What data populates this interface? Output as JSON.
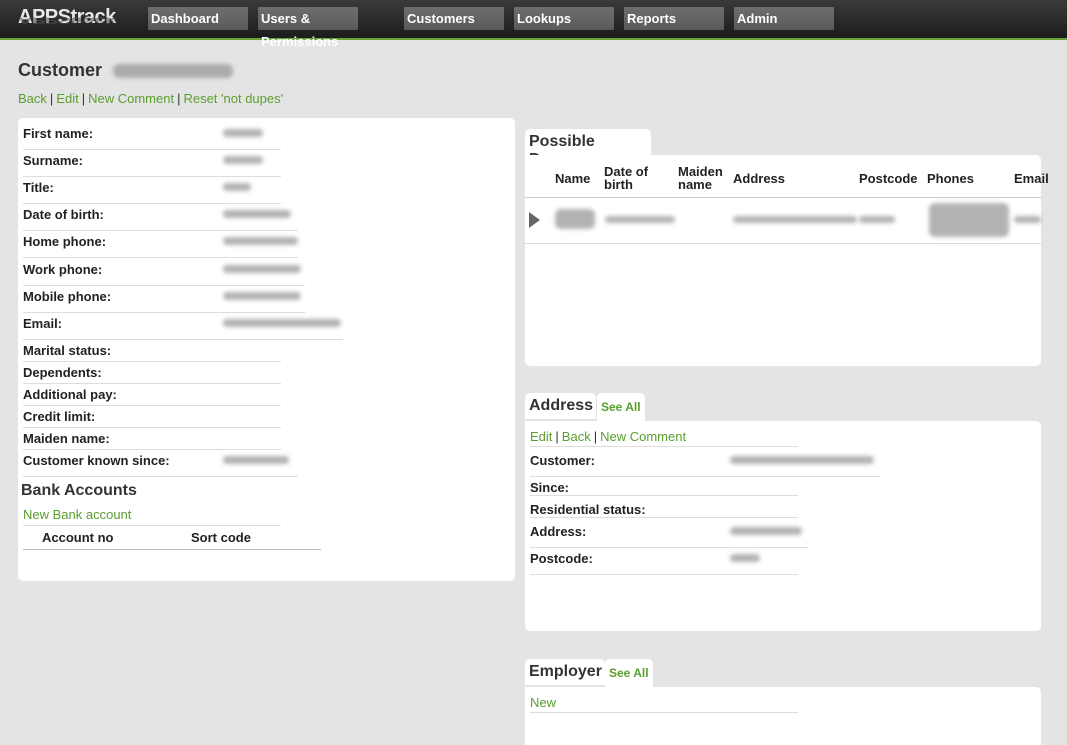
{
  "app": {
    "logo": "APPStrack"
  },
  "nav": {
    "items": [
      "Dashboard",
      "Users & Permissions",
      "Customers",
      "Lookups",
      "Reports",
      "Admin"
    ]
  },
  "page": {
    "title": "Customer",
    "actions": [
      "Back",
      "Edit",
      "New Comment",
      "Reset 'not dupes'"
    ]
  },
  "customer": {
    "fields": [
      {
        "label": "First name:"
      },
      {
        "label": "Surname:"
      },
      {
        "label": "Title:"
      },
      {
        "label": "Date of birth:"
      },
      {
        "label": "Home phone:"
      },
      {
        "label": "Work phone:"
      },
      {
        "label": "Mobile phone:"
      },
      {
        "label": "Email:"
      },
      {
        "label": "Marital status:"
      },
      {
        "label": "Dependents:"
      },
      {
        "label": "Additional pay:"
      },
      {
        "label": "Credit limit:"
      },
      {
        "label": "Maiden name:"
      },
      {
        "label": "Customer known since:"
      }
    ]
  },
  "bank": {
    "title": "Bank Accounts",
    "new_link": "New Bank account",
    "columns": [
      "Account no",
      "Sort code"
    ]
  },
  "dupes": {
    "title": "Possible Dupes",
    "columns": [
      "Name",
      "Date of birth",
      "Maiden name",
      "Address",
      "Postcode",
      "Phones",
      "Email"
    ]
  },
  "address": {
    "title": "Address",
    "see_all": "See All",
    "actions": [
      "Edit",
      "Back",
      "New Comment"
    ],
    "fields": [
      {
        "label": "Customer:"
      },
      {
        "label": "Since:"
      },
      {
        "label": "Residential status:"
      },
      {
        "label": "Address:"
      },
      {
        "label": "Postcode:"
      }
    ]
  },
  "employer": {
    "title": "Employer",
    "see_all": "See All",
    "new_link": "New"
  }
}
